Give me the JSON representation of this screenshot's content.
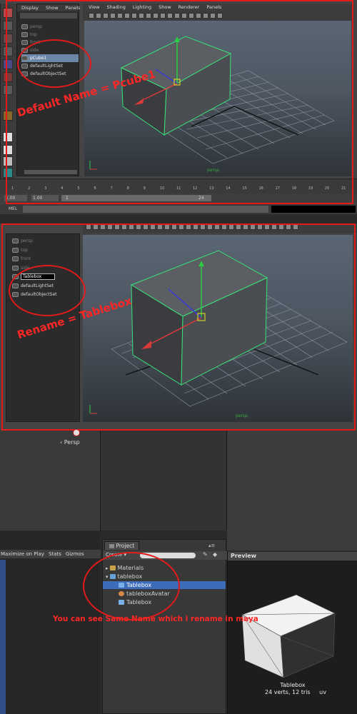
{
  "maya_top": {
    "menu": [
      "Display",
      "Show",
      "Panels"
    ],
    "vp_menu": [
      "View",
      "Shading",
      "Lighting",
      "Show",
      "Renderer",
      "Panels"
    ],
    "outliner": [
      {
        "label": "persp",
        "state": "dim"
      },
      {
        "label": "top",
        "state": "dim"
      },
      {
        "label": "front",
        "state": "dim"
      },
      {
        "label": "side",
        "state": "dim"
      },
      {
        "label": "pCube1",
        "state": "selected"
      },
      {
        "label": "defaultLightSet",
        "state": "normal"
      },
      {
        "label": "defaultObjectSet",
        "state": "normal"
      }
    ],
    "camera_label": "persp",
    "timeline_ticks": [
      "1",
      "2",
      "3",
      "4",
      "5",
      "6",
      "7",
      "8",
      "9",
      "10",
      "11",
      "12",
      "13",
      "14",
      "15",
      "16",
      "17",
      "18",
      "19",
      "20",
      "21"
    ],
    "range": {
      "start": "1.00",
      "start2": "1.00",
      "current": "1",
      "end": "24"
    },
    "cmd_label": "MEL",
    "note": "Default Name = Pcube1"
  },
  "maya_bottom": {
    "outliner": [
      {
        "label": "persp",
        "state": "dim"
      },
      {
        "label": "top",
        "state": "dim"
      },
      {
        "label": "front",
        "state": "dim"
      },
      {
        "label": "side",
        "state": "dim"
      },
      {
        "label": "Tablebox",
        "state": "editing"
      },
      {
        "label": "defaultLightSet",
        "state": "normal"
      },
      {
        "label": "defaultObjectSet",
        "state": "normal"
      }
    ],
    "camera_label": "persp",
    "note": "Rename = Tablebox"
  },
  "unity": {
    "scene_label": "Persp",
    "game_toolbar": [
      "Maximize on Play",
      "Stats",
      "Gizmos"
    ],
    "project_tab": "Project",
    "create_label": "Create",
    "tree": [
      {
        "label": "Materials",
        "indent": 0,
        "type": "folder",
        "state": "normal"
      },
      {
        "label": "tablebox",
        "indent": 0,
        "type": "model",
        "state": "normal"
      },
      {
        "label": "Tablebox",
        "indent": 1,
        "type": "mesh",
        "state": "selected"
      },
      {
        "label": "tableboxAvatar",
        "indent": 1,
        "type": "avatar",
        "state": "normal"
      },
      {
        "label": "Tablebox",
        "indent": 1,
        "type": "mesh",
        "state": "normal"
      }
    ],
    "preview_label": "Preview",
    "preview_name": "Tablebox",
    "preview_stats": "24 verts, 12 tris",
    "preview_uv": "uv",
    "note": "You can see Same Name which i rename in maya"
  },
  "colors": {
    "annotation": "#e11a1a",
    "wireframe": "#39e27a",
    "selection": "#3d6cb8"
  }
}
